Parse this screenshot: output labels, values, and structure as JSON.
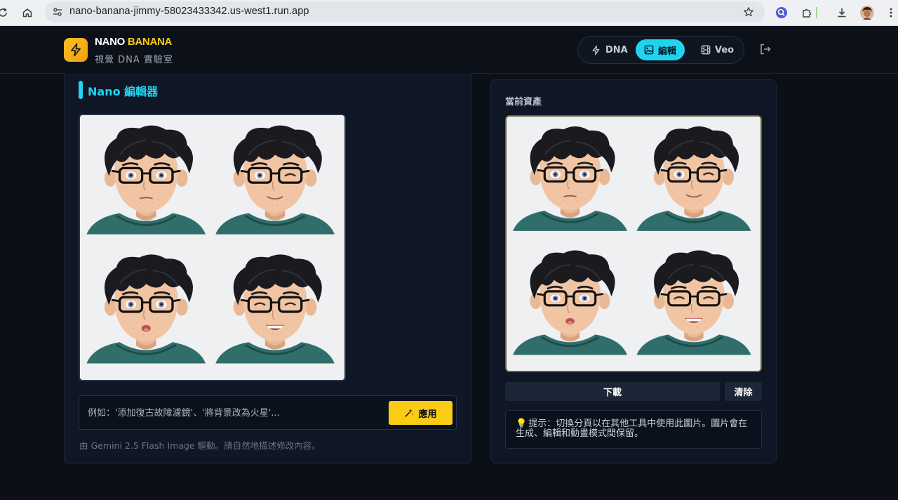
{
  "browser": {
    "url": "nano-banana-jimmy-58023433342.us-west1.run.app",
    "icons": [
      "reload-icon",
      "home-icon",
      "site-settings-icon",
      "bookmark-star-icon",
      "extension-icon",
      "puzzle-icon",
      "download-icon",
      "profile-avatar",
      "menu-icon"
    ]
  },
  "header": {
    "brand_main": "NANO ",
    "brand_accent": "BANANA",
    "brand_sub": "視覺 DNA 實驗室",
    "nav": [
      {
        "label": "DNA",
        "icon": "lightning-icon",
        "active": false
      },
      {
        "label": "編輯",
        "icon": "image-icon",
        "active": true
      },
      {
        "label": "Veo",
        "icon": "film-icon",
        "active": false
      }
    ],
    "logout_icon": "logout-icon"
  },
  "editor": {
    "title": "Nano 編輯器",
    "prompt_placeholder": "例如：'添加復古故障濾鏡'、'將背景改為火星'...",
    "apply_label": "應用",
    "footnote": "由 Gemini 2.5 Flash Image 驅動。請自然地描述修改內容。"
  },
  "asset": {
    "label": "當前資產",
    "download_label": "下載",
    "clear_label": "清除",
    "tip_icon": "💡",
    "tip": "提示：切換分頁以在其他工具中使用此圖片。圖片會在生成、編輯和動畫模式間保留。"
  },
  "colors": {
    "accent_cyan": "#22d3ee",
    "accent_yellow": "#facc15",
    "background": "#0b1018",
    "panel": "#0f1726"
  }
}
